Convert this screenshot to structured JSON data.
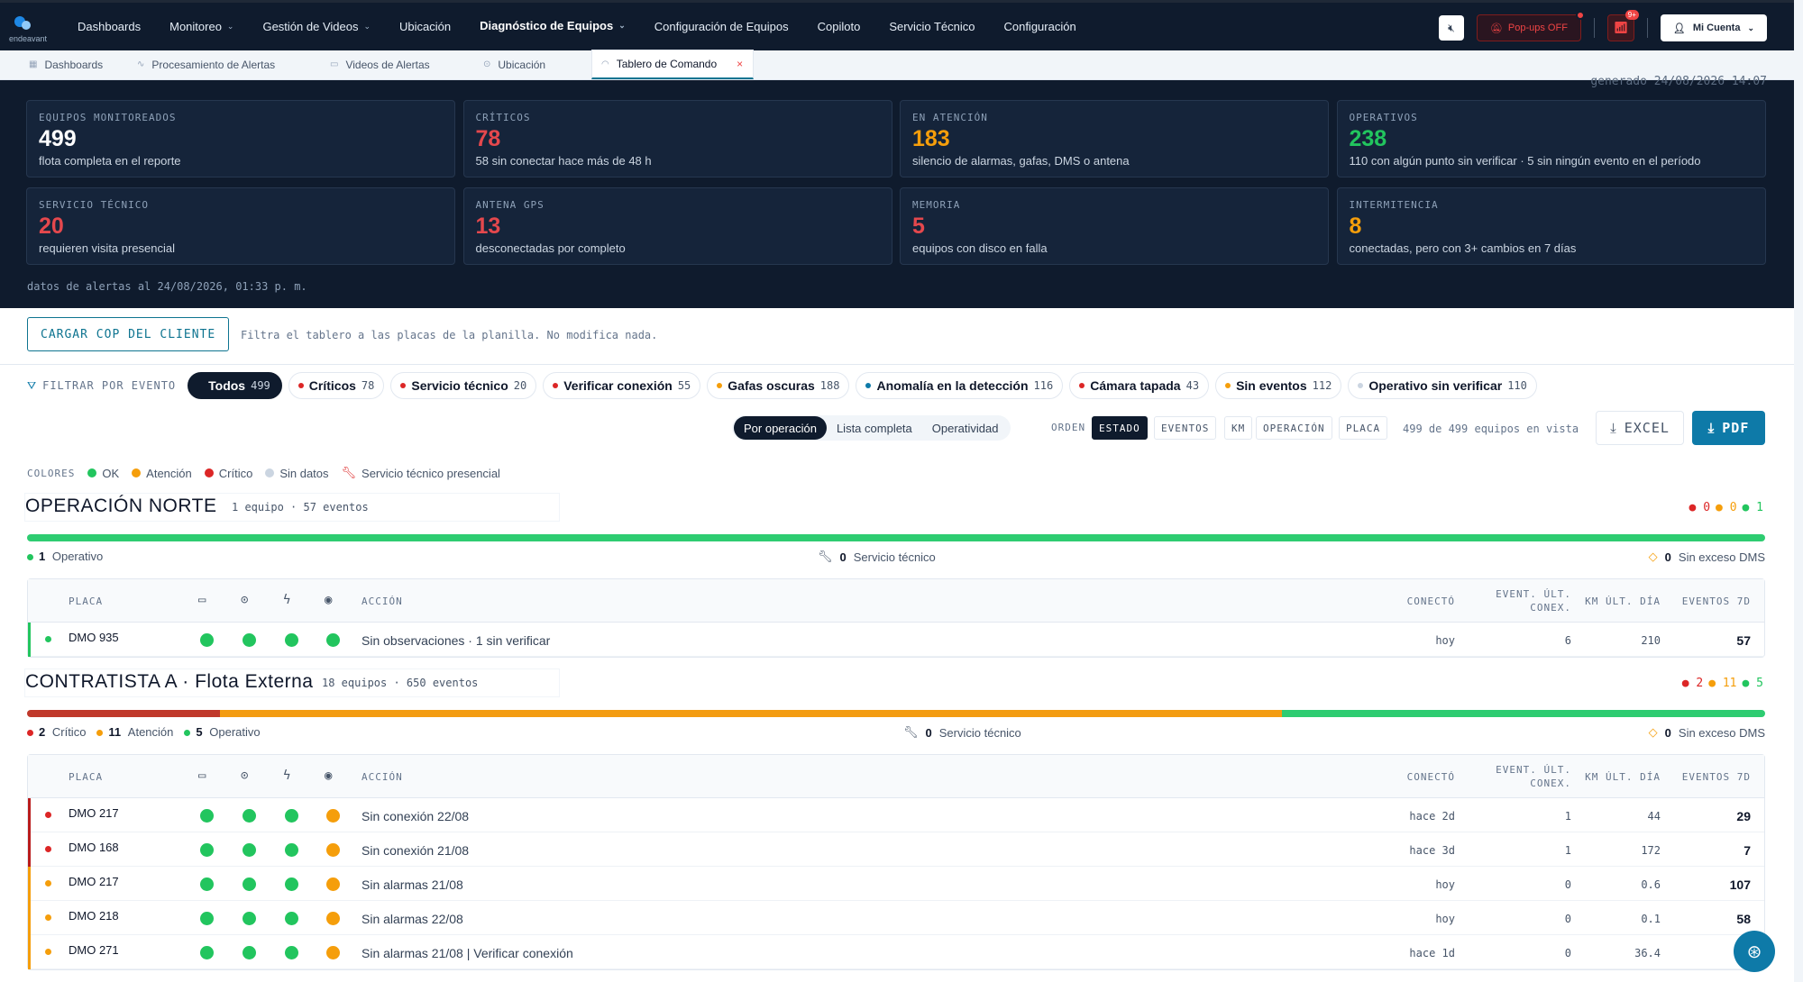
{
  "brand": {
    "logo_text": "endeavant"
  },
  "nav": {
    "items": [
      {
        "label": "Dashboards",
        "caret": false
      },
      {
        "label": "Monitoreo",
        "caret": true
      },
      {
        "label": "Gestión de Videos",
        "caret": true
      },
      {
        "label": "Ubicación",
        "caret": false
      },
      {
        "label": "Diagnóstico de Equipos",
        "caret": true,
        "active": true
      },
      {
        "label": "Configuración de Equipos",
        "caret": false
      },
      {
        "label": "Copiloto",
        "caret": false
      },
      {
        "label": "Servicio Técnico",
        "caret": false
      },
      {
        "label": "Configuración",
        "caret": false
      }
    ],
    "popups_label": "Pop-ups OFF",
    "bell_badge": "9+",
    "account_label": "Mi Cuenta"
  },
  "tabs": [
    {
      "label": "Dashboards",
      "icon": "grid-icon"
    },
    {
      "label": "Procesamiento de Alertas",
      "icon": "pulse-icon"
    },
    {
      "label": "Videos de Alertas",
      "icon": "video-icon"
    },
    {
      "label": "Ubicación",
      "icon": "pin-icon"
    },
    {
      "label": "Tablero de Comando",
      "icon": "gauge-icon",
      "active": true
    }
  ],
  "generated": "generado 24/08/2026 14:07",
  "kpis": [
    {
      "label": "EQUIPOS MONITOREADOS",
      "value": "499",
      "sub": "flota completa en el reporte",
      "color": "#ffffff"
    },
    {
      "label": "CRÍTICOS",
      "value": "78",
      "sub": "58 sin conectar hace más de 48 h",
      "color": "#e5484d"
    },
    {
      "label": "EN ATENCIÓN",
      "value": "183",
      "sub": "silencio de alarmas, gafas, DMS o antena",
      "color": "#f59e0b"
    },
    {
      "label": "OPERATIVOS",
      "value": "238",
      "sub": "110 con algún punto sin verificar · 5 sin ningún evento en el período",
      "color": "#22c55e"
    },
    {
      "label": "SERVICIO TÉCNICO",
      "value": "20",
      "sub": "requieren visita presencial",
      "color": "#e5484d"
    },
    {
      "label": "ANTENA GPS",
      "value": "13",
      "sub": "desconectadas por completo",
      "color": "#e5484d"
    },
    {
      "label": "MEMORIA",
      "value": "5",
      "sub": "equipos con disco en falla",
      "color": "#e5484d"
    },
    {
      "label": "INTERMITENCIA",
      "value": "8",
      "sub": "conectadas, pero con 3+ cambios en 7 días",
      "color": "#f59e0b"
    }
  ],
  "datos_alertas": "datos de alertas al 24/08/2026, 01:33 p. m.",
  "cop": {
    "button": "CARGAR COP DEL CLIENTE",
    "desc": "Filtra el tablero a las placas de la planilla. No modifica nada."
  },
  "filter": {
    "label": "FILTRAR POR EVENTO",
    "chips": [
      {
        "label": "Todos",
        "count": "499",
        "color": "",
        "active": true
      },
      {
        "label": "Críticos",
        "count": "78",
        "color": "#dc2626"
      },
      {
        "label": "Servicio técnico",
        "count": "20",
        "color": "#dc2626"
      },
      {
        "label": "Verificar conexión",
        "count": "55",
        "color": "#dc2626"
      },
      {
        "label": "Gafas oscuras",
        "count": "188",
        "color": "#f59e0b"
      },
      {
        "label": "Anomalía en la detección",
        "count": "116",
        "color": "#0e7aa8"
      },
      {
        "label": "Cámara tapada",
        "count": "43",
        "color": "#dc2626"
      },
      {
        "label": "Sin eventos",
        "count": "112",
        "color": "#f59e0b"
      },
      {
        "label": "Operativo sin verificar",
        "count": "110",
        "color": "#cbd5e1"
      }
    ]
  },
  "views": [
    "Por operación",
    "Lista completa",
    "Operatividad"
  ],
  "orden": {
    "label": "ORDEN",
    "options": [
      "ESTADO",
      "EVENTOS",
      "KM",
      "OPERACIÓN",
      "PLACA"
    ]
  },
  "count_text": "499 de 499 equipos en vista",
  "export": {
    "excel": "EXCEL",
    "pdf": "PDF"
  },
  "legend": {
    "label": "COLORES",
    "items": [
      {
        "label": "OK",
        "color": "#22c55e"
      },
      {
        "label": "Atención",
        "color": "#f59e0b"
      },
      {
        "label": "Crítico",
        "color": "#dc2626"
      },
      {
        "label": "Sin datos",
        "color": "#cbd5e1"
      }
    ],
    "service": "Servicio técnico presencial"
  },
  "table_headers": {
    "placa": "PLACA",
    "accion": "ACCIÓN",
    "conecto": "CONECTÓ",
    "event1": "EVENT. ÚLT.",
    "event2": "CONEX.",
    "km": "KM ÚLT. DÍA",
    "eventos7d": "EVENTOS 7D"
  },
  "groups": [
    {
      "title": "OPERACIÓN NORTE",
      "meta": "1 equipo · 57 eventos",
      "counts": [
        "0",
        "0",
        "1"
      ],
      "bar": {
        "critical": 0,
        "attention": 0,
        "ok": 1
      },
      "summary": [
        {
          "n": "1",
          "label": "Operativo",
          "color": "#22c55e"
        }
      ],
      "service": {
        "n": "0",
        "label": "Servicio técnico"
      },
      "dms": {
        "n": "0",
        "label": "Sin exceso DMS"
      },
      "rows": [
        {
          "placa": "DMO 935",
          "status": "#22c55e",
          "strip": "#22c55e",
          "icons": [
            "#22c55e",
            "#22c55e",
            "#22c55e",
            "#22c55e"
          ],
          "accion": "Sin observaciones · 1 sin verificar",
          "conecto": "hoy",
          "event": "6",
          "km": "210",
          "e7": "57"
        }
      ]
    },
    {
      "title": "CONTRATISTA A · Flota Externa",
      "meta": "18 equipos · 650 eventos",
      "counts": [
        "2",
        "11",
        "5"
      ],
      "bar": {
        "critical": 2,
        "attention": 11,
        "ok": 5
      },
      "summary": [
        {
          "n": "2",
          "label": "Crítico",
          "color": "#dc2626"
        },
        {
          "n": "11",
          "label": "Atención",
          "color": "#f59e0b"
        },
        {
          "n": "5",
          "label": "Operativo",
          "color": "#22c55e"
        }
      ],
      "service": {
        "n": "0",
        "label": "Servicio técnico"
      },
      "dms": {
        "n": "0",
        "label": "Sin exceso DMS"
      },
      "rows": [
        {
          "placa": "DMO 217",
          "status": "#dc2626",
          "strip": "#b91c1c",
          "icons": [
            "#22c55e",
            "#22c55e",
            "#22c55e",
            "#f59e0b"
          ],
          "accion": "Sin conexión 22/08",
          "conecto": "hace 2d",
          "event": "1",
          "km": "44",
          "e7": "29"
        },
        {
          "placa": "DMO 168",
          "status": "#dc2626",
          "strip": "#b91c1c",
          "icons": [
            "#22c55e",
            "#22c55e",
            "#22c55e",
            "#f59e0b"
          ],
          "accion": "Sin conexión 21/08",
          "conecto": "hace 3d",
          "event": "1",
          "km": "172",
          "e7": "7"
        },
        {
          "placa": "DMO 217",
          "status": "#f59e0b",
          "strip": "#f59e0b",
          "icons": [
            "#22c55e",
            "#22c55e",
            "#22c55e",
            "#f59e0b"
          ],
          "accion": "Sin alarmas 21/08",
          "conecto": "hoy",
          "event": "0",
          "km": "0.6",
          "e7": "107"
        },
        {
          "placa": "DMO 218",
          "status": "#f59e0b",
          "strip": "#f59e0b",
          "icons": [
            "#22c55e",
            "#22c55e",
            "#22c55e",
            "#f59e0b"
          ],
          "accion": "Sin alarmas 22/08",
          "conecto": "hoy",
          "event": "0",
          "km": "0.1",
          "e7": "58"
        },
        {
          "placa": "DMO 271",
          "status": "#f59e0b",
          "strip": "#f59e0b",
          "icons": [
            "#22c55e",
            "#22c55e",
            "#22c55e",
            "#f59e0b"
          ],
          "accion": "Sin alarmas 21/08 | Verificar conexión",
          "conecto": "hace 1d",
          "event": "0",
          "km": "36.4",
          "e7": ""
        }
      ]
    }
  ]
}
